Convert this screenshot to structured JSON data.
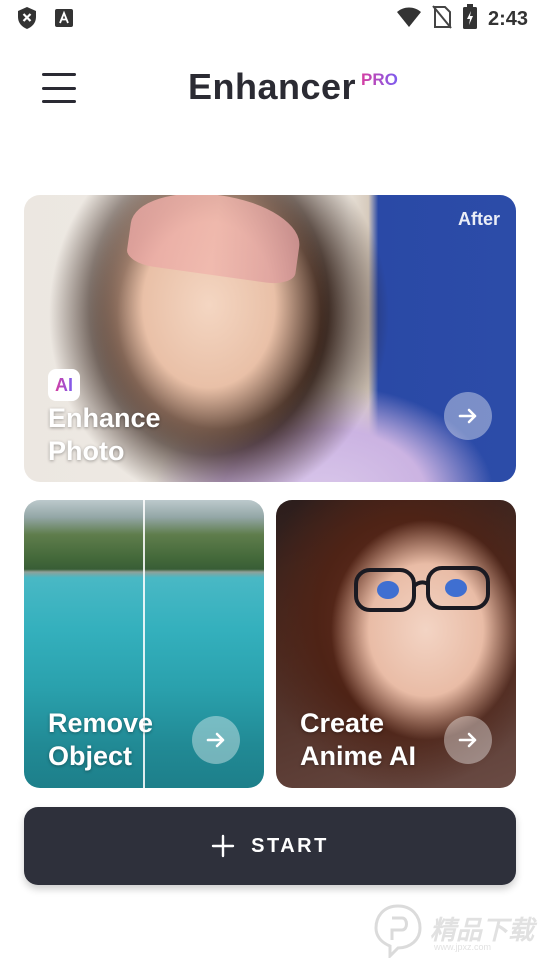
{
  "status_bar": {
    "time": "2:43",
    "icons": [
      "shield-icon",
      "font-icon",
      "wifi-icon",
      "no-sim-icon",
      "battery-charging-icon"
    ]
  },
  "header": {
    "title": "Enhancer",
    "badge": "PRO",
    "menu_icon": "hamburger-menu-icon"
  },
  "cards": {
    "enhance": {
      "badge": "AI",
      "label_line1": "Enhance",
      "label_line2": "Photo",
      "after_label": "After",
      "arrow_icon": "arrow-right-icon"
    },
    "remove": {
      "label_line1": "Remove",
      "label_line2": "Object",
      "arrow_icon": "arrow-right-icon"
    },
    "anime": {
      "label_line1": "Create",
      "label_line2": "Anime AI",
      "arrow_icon": "arrow-right-icon"
    }
  },
  "start_button": {
    "label": "START",
    "icon": "plus-icon"
  },
  "watermark": {
    "text": "精品下载",
    "sub": "www.jpxz.com"
  },
  "colors": {
    "title": "#2b2b33",
    "pro_gradient_start": "#d63ea1",
    "pro_gradient_end": "#7b5cf0",
    "start_button_bg": "#2e303b"
  }
}
